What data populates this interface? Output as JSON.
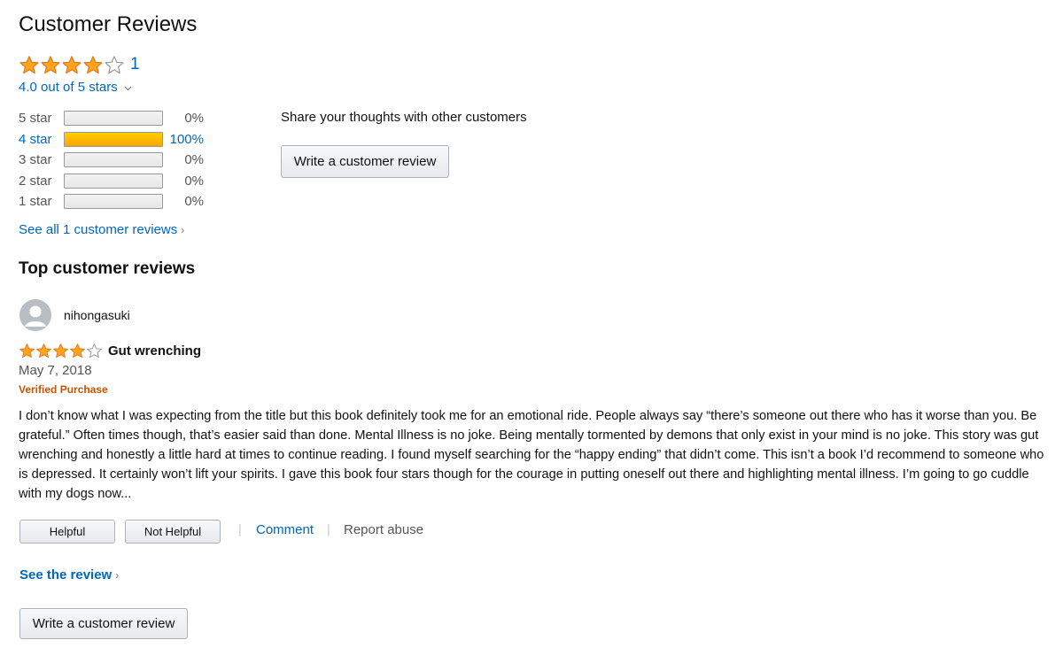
{
  "header": {
    "title": "Customer Reviews"
  },
  "summary": {
    "rating": 4,
    "max_rating": 5,
    "count_label": "1",
    "out_of_label": "4.0 out of 5 stars",
    "chevron": "›"
  },
  "histogram": [
    {
      "label": "5 star",
      "percent_label": "0%",
      "fill": 0,
      "link": false
    },
    {
      "label": "4 star",
      "percent_label": "100%",
      "fill": 1,
      "link": true
    },
    {
      "label": "3 star",
      "percent_label": "0%",
      "fill": 0,
      "link": false
    },
    {
      "label": "2 star",
      "percent_label": "0%",
      "fill": 0,
      "link": false
    },
    {
      "label": "1 star",
      "percent_label": "0%",
      "fill": 0,
      "link": false
    }
  ],
  "see_all": {
    "label": "See all 1 customer reviews",
    "chevron": "›"
  },
  "share": {
    "text": "Share your thoughts with other customers",
    "button_label": "Write a customer review"
  },
  "top_reviews": {
    "heading": "Top customer reviews",
    "review": {
      "author": "nihongasuki",
      "rating": 4,
      "title": "Gut wrenching",
      "date": "May 7, 2018",
      "verified": "Verified Purchase",
      "body": "I don’t know what I was expecting from the title but this book definitely took me for an emotional ride. People always say “there’s someone out there who has it worse than you. Be grateful.” Often times though, that’s easier said than done. Mental Illness is no joke. Being mentally tormented by demons that only exist in your mind is no joke. This story was gut wrenching and honestly a little hard at times to continue reading. I found myself searching for the “happy ending” that didn’t come. This isn’t a book I’d recommend to someone who is depressed. It certainly won’t lift your spirits. I gave this book four stars though for the courage in putting oneself out there and highlighting mental illness. I’m going to go cuddle with my dogs now...",
      "helpful_label": "Helpful",
      "not_helpful_label": "Not Helpful",
      "separator": "|",
      "comment_label": "Comment",
      "report_label": "Report abuse"
    },
    "see_review": {
      "label": "See the review",
      "chevron": "›"
    }
  },
  "bottom_button_label": "Write a customer review",
  "colors": {
    "link": "#0066c0",
    "star": "#ffa41c",
    "verified": "#c45500",
    "bar_fill": "#ffa700"
  },
  "icons": {
    "star_full": "star-icon",
    "star_empty": "star-empty-icon",
    "avatar": "avatar-icon",
    "chevron_down": "chevron-down-icon",
    "chevron_right": "chevron-right-icon"
  }
}
